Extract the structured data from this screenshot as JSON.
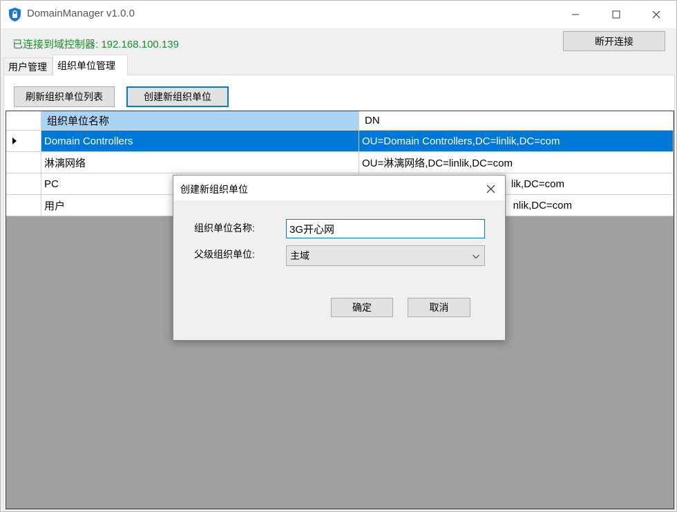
{
  "window": {
    "title": "DomainManager v1.0.0",
    "icon": "shield-lock-icon",
    "controls": [
      "minimize-icon",
      "maximize-icon",
      "close-icon"
    ]
  },
  "status": {
    "text": "已连接到域控制器: 192.168.100.139",
    "color": "#1a8f2c"
  },
  "toolbar": {
    "disconnect_label": "断开连接"
  },
  "tabs": [
    {
      "label": "用户管理",
      "active": false
    },
    {
      "label": "组织单位管理",
      "active": true
    }
  ],
  "ou_page": {
    "refresh_label": "刷新组织单位列表",
    "create_label": "创建新组织单位"
  },
  "grid": {
    "columns": [
      "组织单位名称",
      "DN"
    ],
    "rows": [
      {
        "name": "Domain Controllers",
        "dn": "OU=Domain Controllers,DC=linlik,DC=com",
        "selected": true
      },
      {
        "name": "淋漓网络",
        "dn": "OU=淋漓网络,DC=linlik,DC=com",
        "selected": false
      },
      {
        "name": "PC",
        "dn": "lik,DC=com",
        "selected": false
      },
      {
        "name": "用户",
        "dn": "nlik,DC=com",
        "selected": false
      }
    ],
    "selection_color": "#0078d7"
  },
  "dialog": {
    "title": "创建新组织单位",
    "name_label": "组织单位名称:",
    "name_value": "3G开心网",
    "parent_label": "父级组织单位:",
    "parent_value": "主域",
    "ok_label": "确定",
    "cancel_label": "取消"
  }
}
